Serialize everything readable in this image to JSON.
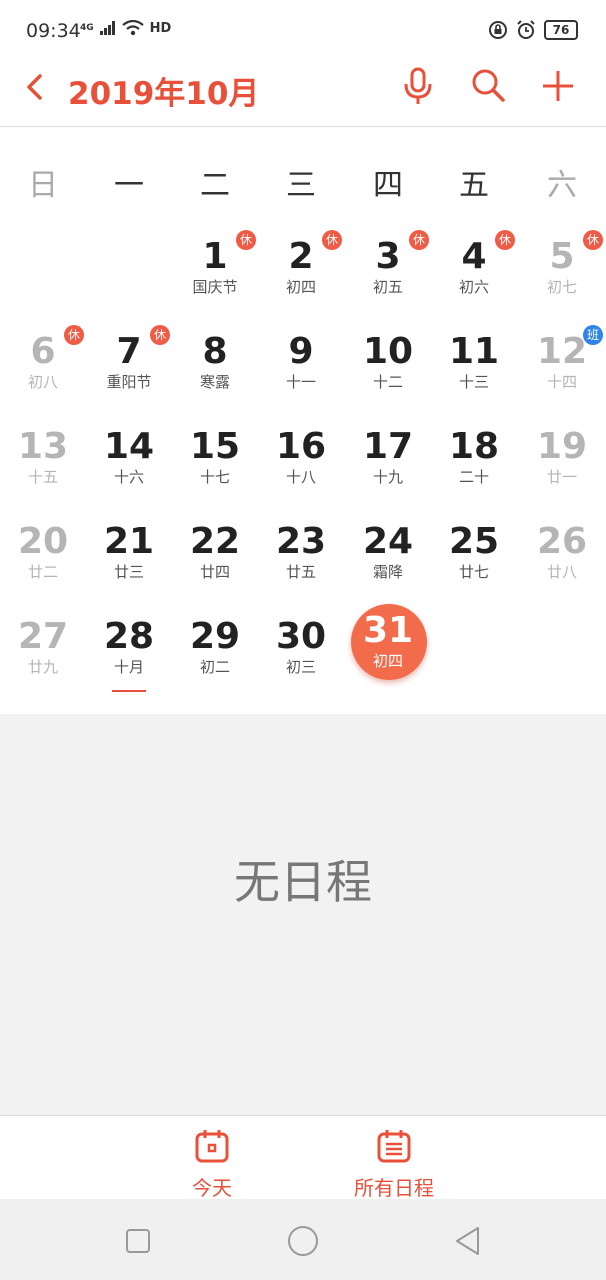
{
  "status": {
    "time": "09:34",
    "network": "4G",
    "hd": "HD",
    "battery": "76"
  },
  "header": {
    "title": "2019年10月"
  },
  "weekdays": [
    "日",
    "一",
    "二",
    "三",
    "四",
    "五",
    "六"
  ],
  "weeks": [
    [
      null,
      null,
      {
        "day": "1",
        "lunar": "国庆节",
        "badge": "休",
        "badge_type": "rest",
        "dim": false
      },
      {
        "day": "2",
        "lunar": "初四",
        "badge": "休",
        "badge_type": "rest",
        "dim": false
      },
      {
        "day": "3",
        "lunar": "初五",
        "badge": "休",
        "badge_type": "rest",
        "dim": false
      },
      {
        "day": "4",
        "lunar": "初六",
        "badge": "休",
        "badge_type": "rest",
        "dim": false
      },
      {
        "day": "5",
        "lunar": "初七",
        "badge": "休",
        "badge_type": "rest",
        "dim": true
      }
    ],
    [
      {
        "day": "6",
        "lunar": "初八",
        "badge": "休",
        "badge_type": "rest",
        "dim": true
      },
      {
        "day": "7",
        "lunar": "重阳节",
        "badge": "休",
        "badge_type": "rest",
        "dim": false
      },
      {
        "day": "8",
        "lunar": "寒露",
        "dim": false
      },
      {
        "day": "9",
        "lunar": "十一",
        "dim": false
      },
      {
        "day": "10",
        "lunar": "十二",
        "dim": false
      },
      {
        "day": "11",
        "lunar": "十三",
        "dim": false
      },
      {
        "day": "12",
        "lunar": "十四",
        "badge": "班",
        "badge_type": "work",
        "dim": true
      }
    ],
    [
      {
        "day": "13",
        "lunar": "十五",
        "dim": true
      },
      {
        "day": "14",
        "lunar": "十六",
        "dim": false
      },
      {
        "day": "15",
        "lunar": "十七",
        "dim": false
      },
      {
        "day": "16",
        "lunar": "十八",
        "dim": false
      },
      {
        "day": "17",
        "lunar": "十九",
        "dim": false
      },
      {
        "day": "18",
        "lunar": "二十",
        "dim": false
      },
      {
        "day": "19",
        "lunar": "廿一",
        "dim": true
      }
    ],
    [
      {
        "day": "20",
        "lunar": "廿二",
        "dim": true
      },
      {
        "day": "21",
        "lunar": "廿三",
        "dim": false
      },
      {
        "day": "22",
        "lunar": "廿四",
        "dim": false
      },
      {
        "day": "23",
        "lunar": "廿五",
        "dim": false
      },
      {
        "day": "24",
        "lunar": "霜降",
        "dim": false
      },
      {
        "day": "25",
        "lunar": "廿七",
        "dim": false
      },
      {
        "day": "26",
        "lunar": "廿八",
        "dim": true
      }
    ],
    [
      {
        "day": "27",
        "lunar": "廿九",
        "dim": true
      },
      {
        "day": "28",
        "lunar": "十月",
        "dim": false,
        "today": true
      },
      {
        "day": "29",
        "lunar": "初二",
        "dim": false
      },
      {
        "day": "30",
        "lunar": "初三",
        "dim": false
      },
      {
        "day": "31",
        "lunar": "初四",
        "dim": false,
        "selected": true
      },
      null,
      null
    ]
  ],
  "events": {
    "empty_text": "无日程"
  },
  "bottom_tabs": {
    "today": "今天",
    "all": "所有日程"
  },
  "colors": {
    "accent": "#e8503a",
    "rest_badge": "#f05b45",
    "work_badge": "#2f84e8",
    "selected": "#f26c4c"
  },
  "icons": [
    "back-icon",
    "microphone-icon",
    "search-icon",
    "add-icon",
    "calendar-today-icon",
    "calendar-list-icon"
  ]
}
